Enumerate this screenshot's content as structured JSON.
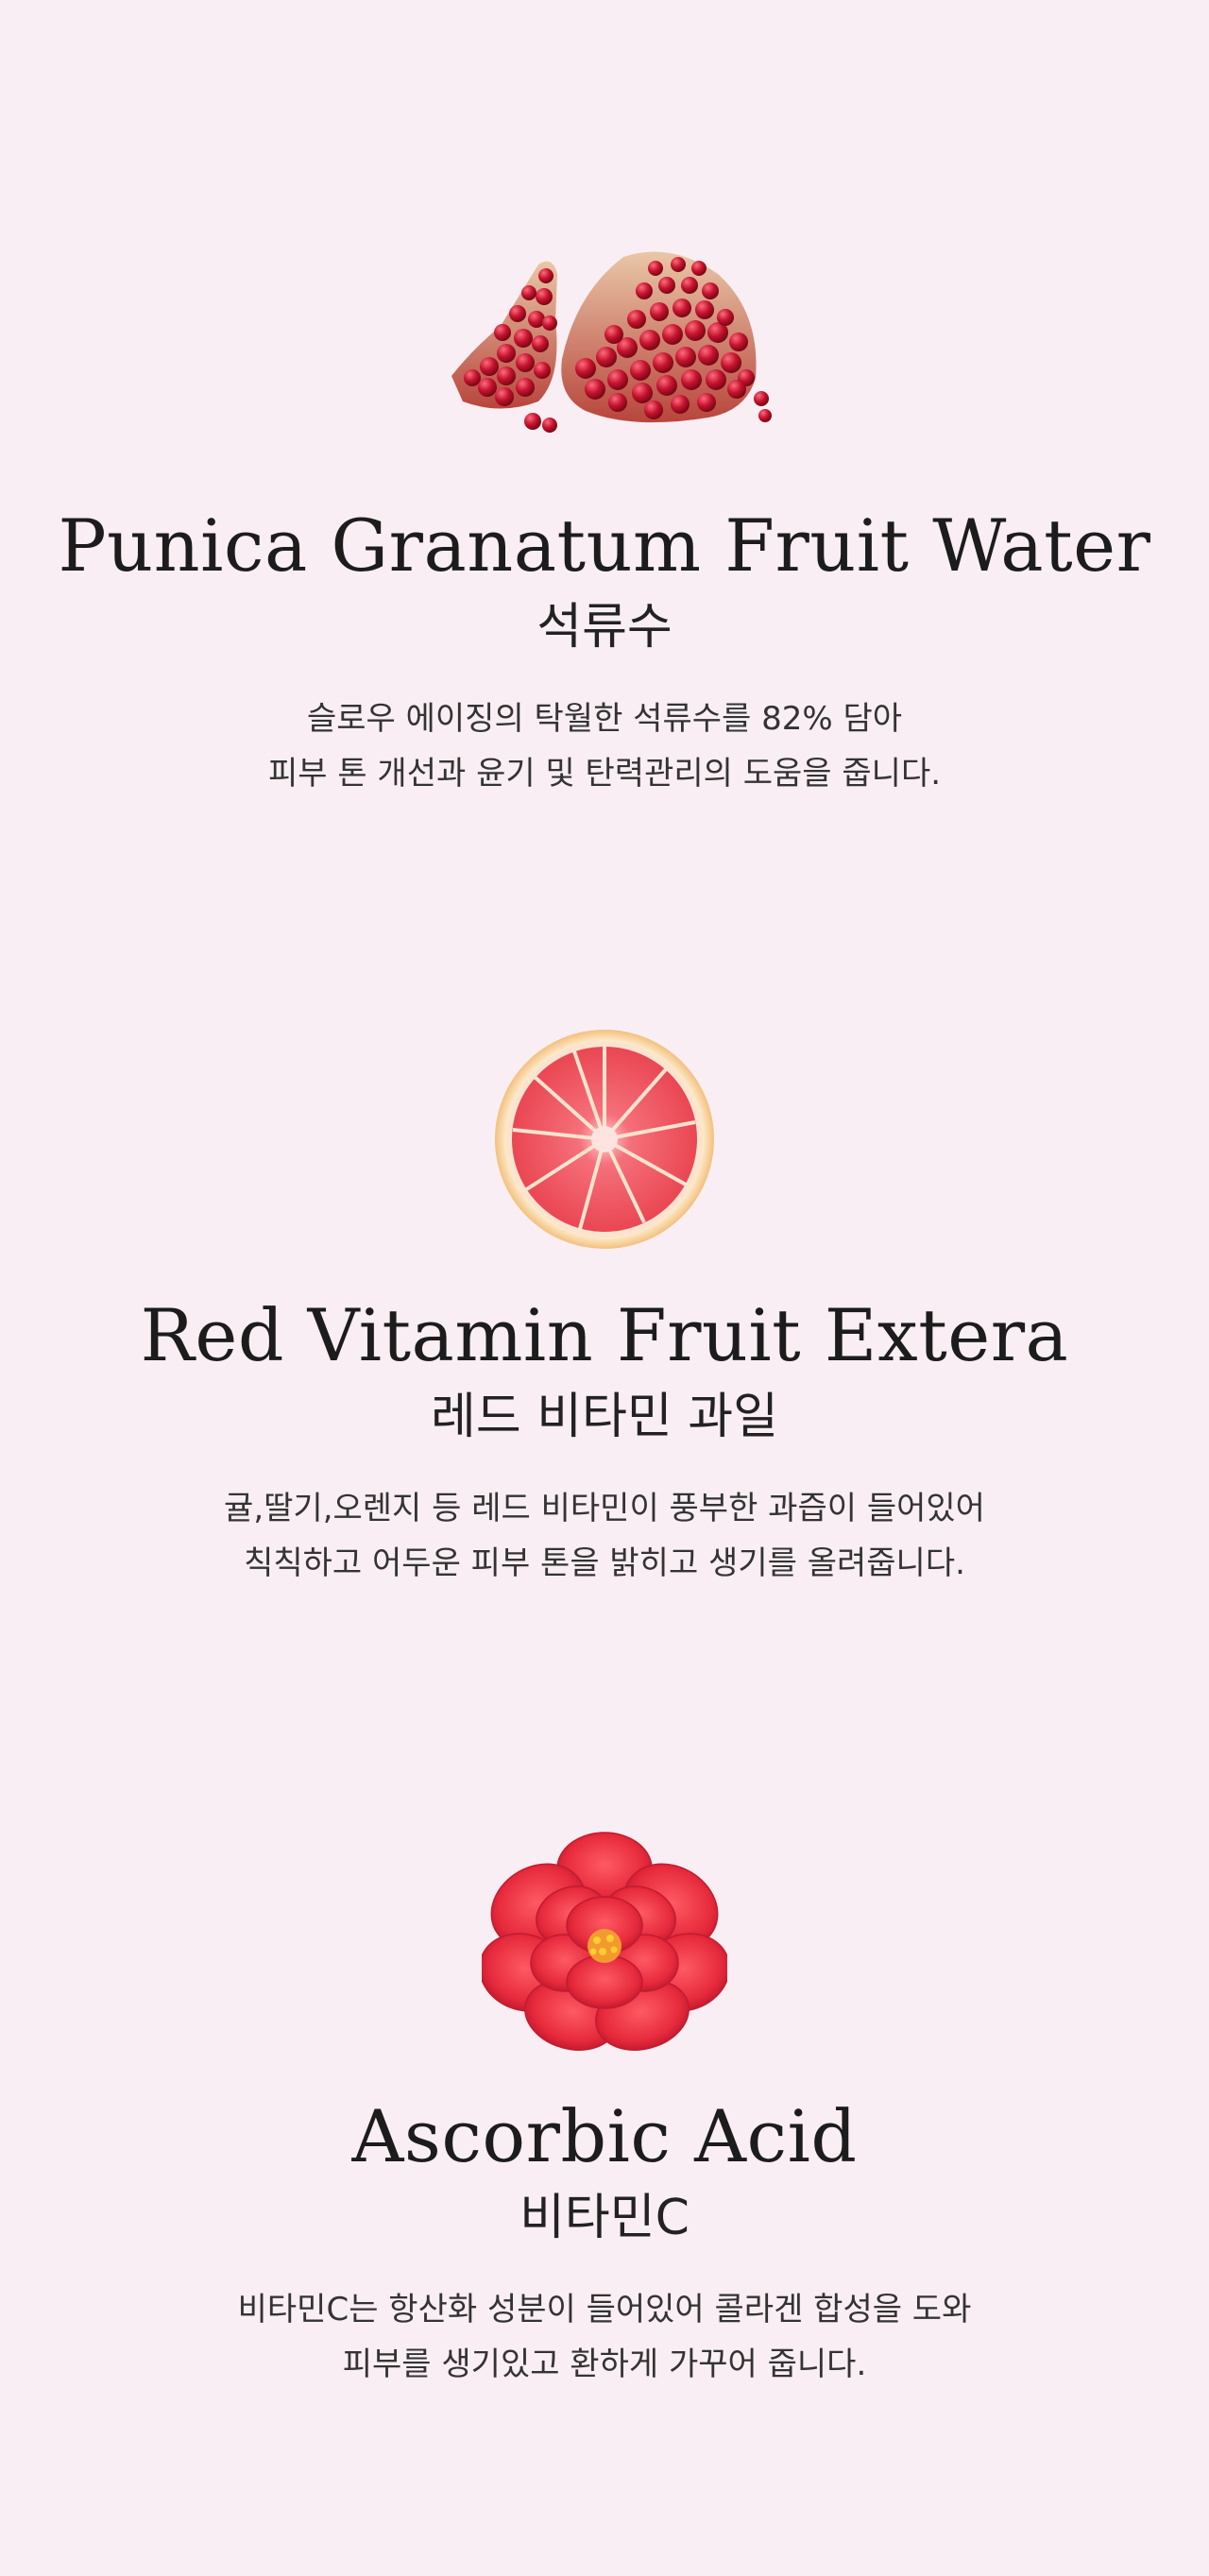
{
  "sections": [
    {
      "illustration": "pomegranate-image",
      "title_en": "Punica Granatum Fruit Water",
      "title_ko": "석류수",
      "description": [
        "슬로우 에이징의 탁월한 석류수를 82% 담아",
        "피부 톤 개선과 윤기 및 탄력관리의 도움을 줍니다."
      ]
    },
    {
      "illustration": "grapefruit-image",
      "title_en": "Red Vitamin Fruit Extera",
      "title_ko": "레드 비타민 과일",
      "description": [
        "귤,딸기,오렌지 등 레드 비타민이 풍부한 과즙이 들어있어",
        "칙칙하고 어두운 피부 톤을 밝히고 생기를 올려줍니다."
      ]
    },
    {
      "illustration": "camellia-flower-image",
      "title_en": "Ascorbic Acid",
      "title_ko": "비타민C",
      "description": [
        "비타민C는 항산화 성분이 들어있어 콜라겐 합성을 도와",
        "피부를 생기있고 환하게 가꾸어 줍니다."
      ]
    }
  ],
  "colors": {
    "background": "#f9eef3",
    "text": "#1c1c1c",
    "pomegranate": "#b8132b",
    "grapefruit": "#f0505a",
    "camellia": "#e8283e"
  }
}
